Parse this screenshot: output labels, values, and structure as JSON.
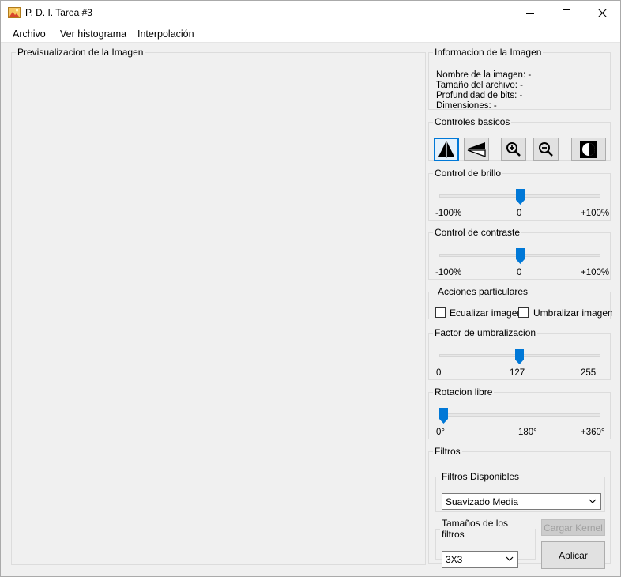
{
  "window": {
    "title": "P. D. I. Tarea #3",
    "controls": {
      "minimize": "minimize-icon",
      "maximize": "maximize-icon",
      "close": "close-icon"
    }
  },
  "menu": {
    "archivo": "Archivo",
    "histograma": "Ver histograma",
    "interpolacion": "Interpolación"
  },
  "preview": {
    "title": "Previsualizacion de la Imagen"
  },
  "info": {
    "title": "Informacion de la Imagen",
    "nombre": "Nombre de la imagen:  -",
    "tamano": "Tamaño del archivo:  -",
    "profundidad": "Profundidad de bits:  -",
    "dimensiones": "Dimensiones:    -"
  },
  "basic_controls": {
    "title": "Controles basicos",
    "buttons": [
      "flip-horizontal-icon",
      "flip-vertical-icon",
      "zoom-in-icon",
      "zoom-out-icon",
      "invert-icon"
    ],
    "active": "flip-horizontal-icon"
  },
  "brightness": {
    "title": "Control de brillo",
    "min": "-100%",
    "mid": "0",
    "max": "+100%",
    "value_fraction": 0.5
  },
  "contrast": {
    "title": "Control de contraste",
    "min": "-100%",
    "mid": "0",
    "max": "+100%",
    "value_fraction": 0.5
  },
  "actions": {
    "title": "Acciones particulares",
    "equalize": "Ecualizar imagen",
    "equalize_checked": false,
    "threshold": "Umbralizar imagen",
    "threshold_checked": false
  },
  "threshold_factor": {
    "title": "Factor de umbralizacion",
    "min": "0",
    "mid": "127",
    "max": "255",
    "value": 127
  },
  "rotation": {
    "title": "Rotacion libre",
    "min": "0°",
    "mid": "180°",
    "max": "+360°",
    "value": 0
  },
  "filters": {
    "title": "Filtros",
    "available_title": "Filtros Disponibles",
    "selected_filter": "Suavizado Media",
    "sizes_title": "Tamaños de los filtros",
    "selected_size": "3X3",
    "load_kernel": "Cargar Kernel",
    "apply": "Aplicar"
  },
  "colors": {
    "accent": "#0078d7",
    "group_border": "#dcdcdc",
    "background": "#f0f0f0"
  }
}
